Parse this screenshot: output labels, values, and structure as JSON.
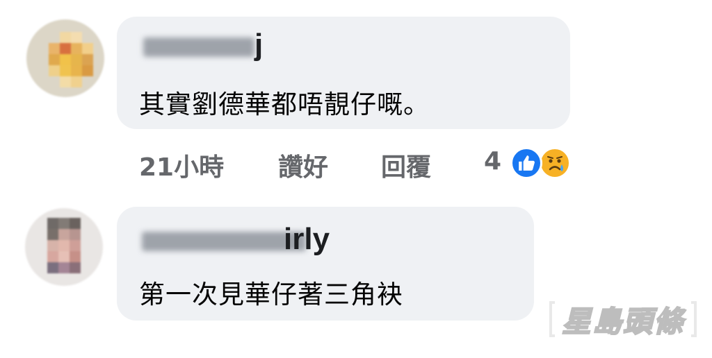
{
  "comments": [
    {
      "author_visible": "j",
      "text": "其實劉德華都唔靚仔嘅。",
      "time": "21小時",
      "like_action": "讚好",
      "reply_action": "回覆",
      "reaction_count": "4",
      "reactions": [
        "like-icon",
        "sad-icon"
      ]
    },
    {
      "author_visible": "irly",
      "text": "第一次見華仔著三角袂"
    }
  ],
  "watermark": {
    "text": "星島頭條"
  },
  "colors": {
    "bubble": "#eff1f4",
    "meta_text": "#65676b",
    "like_blue": "#1877f2",
    "sad_yellow": "#f7b125"
  }
}
